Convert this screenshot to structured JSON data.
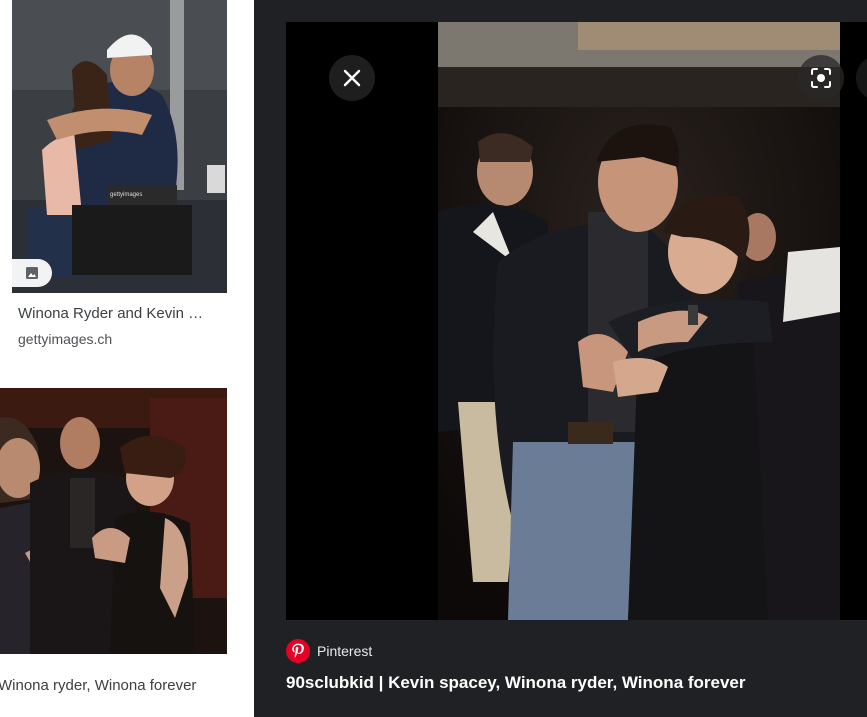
{
  "results": [
    {
      "title": "Winona Ryder and Kevin …",
      "source": "gettyimages.ch",
      "badge_icon": "image-icon",
      "watermark": "gettyimages"
    },
    {
      "title": "Winona ryder, Winona forever"
    }
  ],
  "preview": {
    "source_name": "Pinterest",
    "source_icon": "pinterest-logo",
    "title": "90sclubkid | Kevin spacey, Winona ryder, Winona forever",
    "close_icon": "close-icon",
    "lens_icon": "lens-search-icon",
    "more_icon": "more-vert-icon"
  },
  "colors": {
    "panel_bg": "#202124",
    "pinterest_red": "#e60023",
    "title_text": "#ffffff",
    "caption_text": "#3c4043"
  }
}
